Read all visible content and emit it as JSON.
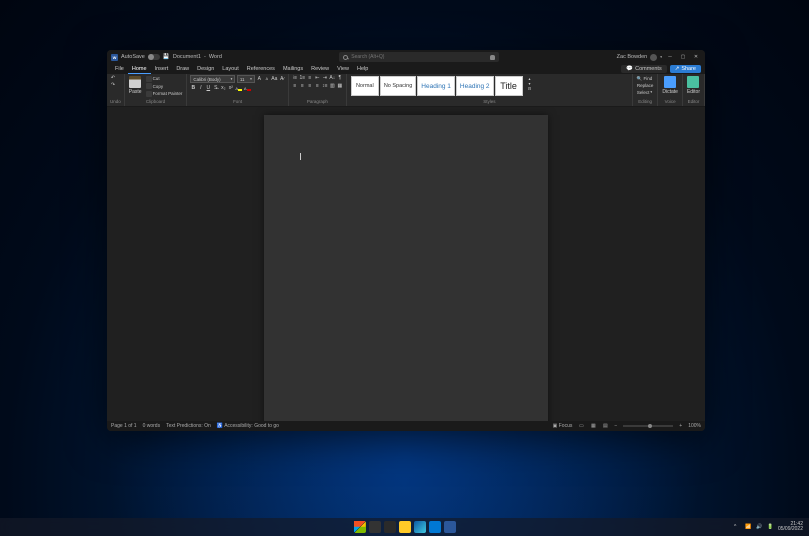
{
  "titlebar": {
    "autosave_label": "AutoSave",
    "doc_name": "Document1",
    "app_name": "Word",
    "search_placeholder": "Search (Alt+Q)",
    "user_name": "Zac Bowden"
  },
  "menubar": {
    "tabs": [
      "File",
      "Home",
      "Insert",
      "Draw",
      "Design",
      "Layout",
      "References",
      "Mailings",
      "Review",
      "View",
      "Help"
    ],
    "active": "Home",
    "comments": "Comments",
    "share": "Share"
  },
  "ribbon": {
    "undo": {
      "label": "Undo"
    },
    "clipboard": {
      "paste": "Paste",
      "cut": "Cut",
      "copy": "Copy",
      "format_painter": "Format Painter",
      "label": "Clipboard"
    },
    "font": {
      "name": "Calibri (Body)",
      "size": "11",
      "label": "Font"
    },
    "paragraph": {
      "label": "Paragraph"
    },
    "styles": {
      "items": [
        "Normal",
        "No Spacing",
        "Heading 1",
        "Heading 2",
        "Title"
      ],
      "label": "Styles"
    },
    "editing": {
      "find": "Find",
      "replace": "Replace",
      "select": "Select",
      "label": "Editing"
    },
    "voice": {
      "dictate": "Dictate",
      "label": "Voice"
    },
    "editor": {
      "editor": "Editor",
      "label": "Editor"
    }
  },
  "statusbar": {
    "page": "Page 1 of 1",
    "words": "0 words",
    "predictions": "Text Predictions: On",
    "accessibility": "Accessibility: Good to go",
    "focus": "Focus",
    "zoom": "100%"
  },
  "system": {
    "time": "21:42",
    "date": "05/09/2022"
  }
}
